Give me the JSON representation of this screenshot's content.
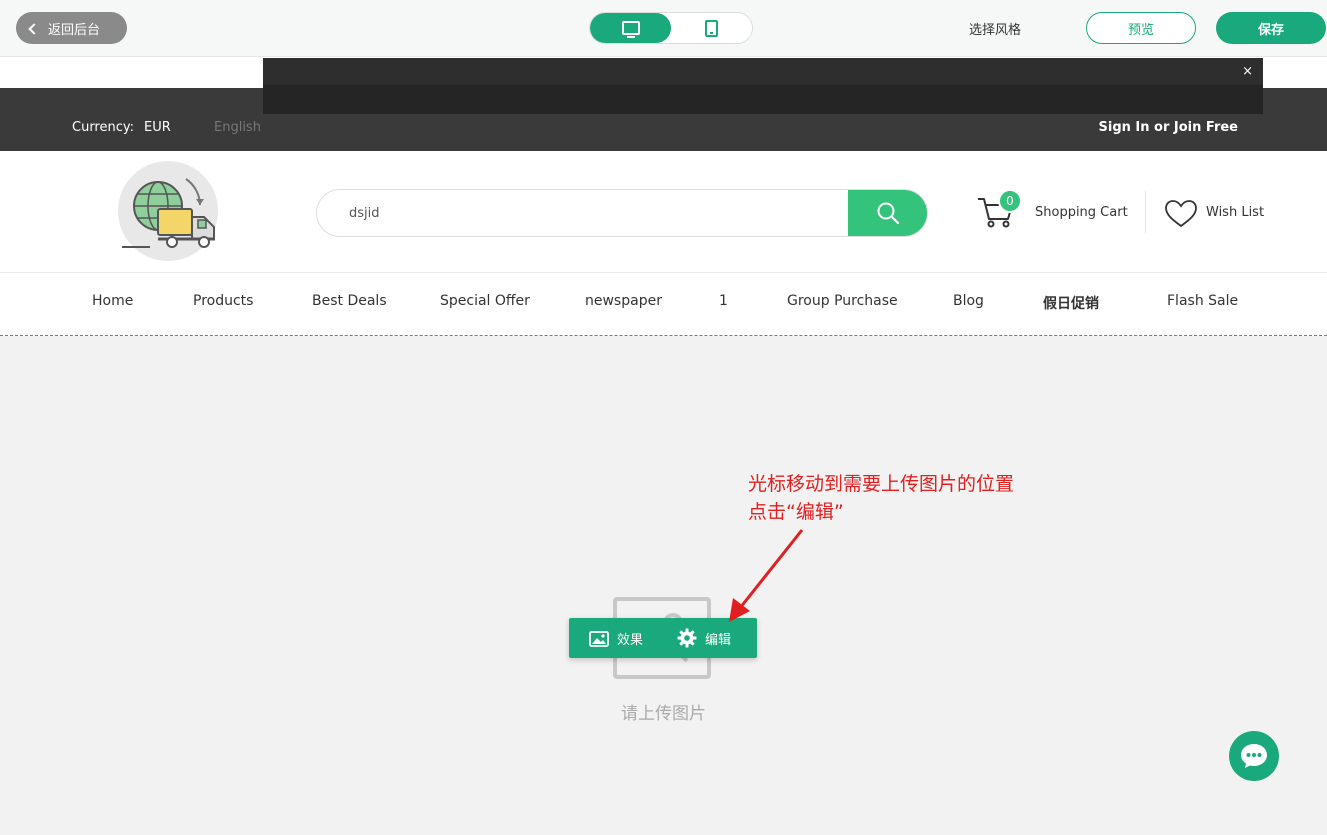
{
  "editor": {
    "back_label": "返回后台",
    "style_label": "选择风格",
    "preview_label": "预览",
    "save_label": "保存",
    "accent_color": "#1aa97c"
  },
  "site": {
    "notice_close": "×",
    "currency_label": "Currency:",
    "currency_value": "EUR",
    "language": "English",
    "signin": "Sign In or Join Free",
    "search_value": "dsjid",
    "cart_count": "0",
    "cart_label": "Shopping Cart",
    "wish_label": "Wish List",
    "nav": [
      "Home",
      "Products",
      "Best Deals",
      "Special Offer",
      "newspaper",
      "1",
      "Group Purchase",
      "Blog",
      "假日促销",
      "Flash Sale"
    ]
  },
  "uploader": {
    "effect_label": "效果",
    "edit_label": "编辑",
    "hint": "请上传图片"
  },
  "annotation": {
    "line1": "光标移动到需要上传图片的位置",
    "line2": "点击“编辑”",
    "color": "#e02020"
  }
}
